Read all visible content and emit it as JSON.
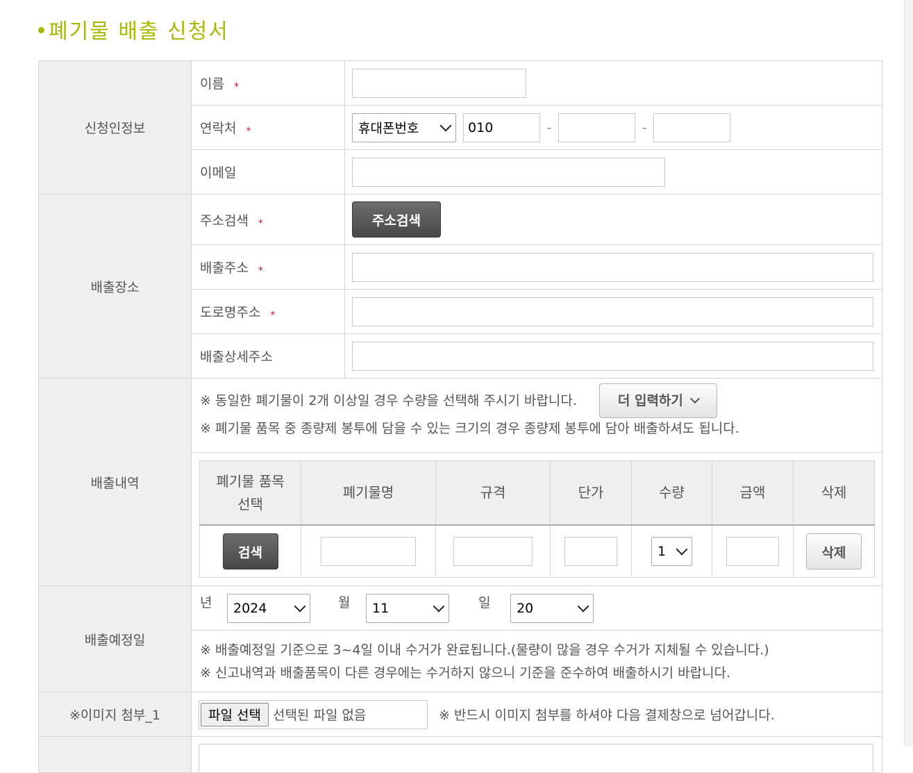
{
  "title": "폐기물 배출 신청서",
  "applicant": {
    "section": "신청인정보",
    "name_label": "이름",
    "contact_label": "연락처",
    "phone_type": "휴대폰번호",
    "phone_prefix": "010",
    "phone_mid": "",
    "phone_last": "",
    "email_label": "이메일",
    "required_mark": "*"
  },
  "location": {
    "section": "배출장소",
    "search_label": "주소검색",
    "search_button": "주소검색",
    "address_label": "배출주소",
    "road_label": "도로명주소",
    "detail_label": "배출상세주소"
  },
  "items": {
    "section": "배출내역",
    "note1": "※ 동일한 폐기물이 2개 이상일 경우 수량을 선택해 주시기 바랍니다.",
    "more_button": "더 입력하기",
    "note2": "※ 폐기물 품목 중 종량제 봉투에 담을 수 있는 크기의 경우 종량제 봉투에 담아 배출하셔도 됩니다.",
    "headers": {
      "select_line1": "폐기물 품목",
      "select_line2": "선택",
      "name": "폐기물명",
      "spec": "규격",
      "unit_price": "단가",
      "quantity": "수량",
      "amount": "금액",
      "delete": "삭제"
    },
    "row": {
      "search_button": "검색",
      "quantity": "1",
      "delete_button": "삭제"
    }
  },
  "date": {
    "section": "배출예정일",
    "year_label": "년",
    "year": "2024",
    "month_label": "월",
    "month": "11",
    "day_label": "일",
    "day": "20",
    "note1": "※ 배출예정일 기준으로 3~4일 이내 수거가 완료됩니다.(물량이 많을 경우 수거가 지체될 수 있습니다.)",
    "note2": "※ 신고내역과 배출품목이 다른 경우에는 수거하지 않으니 기준을 준수하여 배출하시기 바랍니다."
  },
  "attachment": {
    "section": "※이미지 첨부_1",
    "file_button": "파일 선택",
    "file_status": "선택된 파일 없음",
    "note": "※ 반드시 이미지 첨부를 하셔야 다음 결제창으로 넘어갑니다."
  }
}
